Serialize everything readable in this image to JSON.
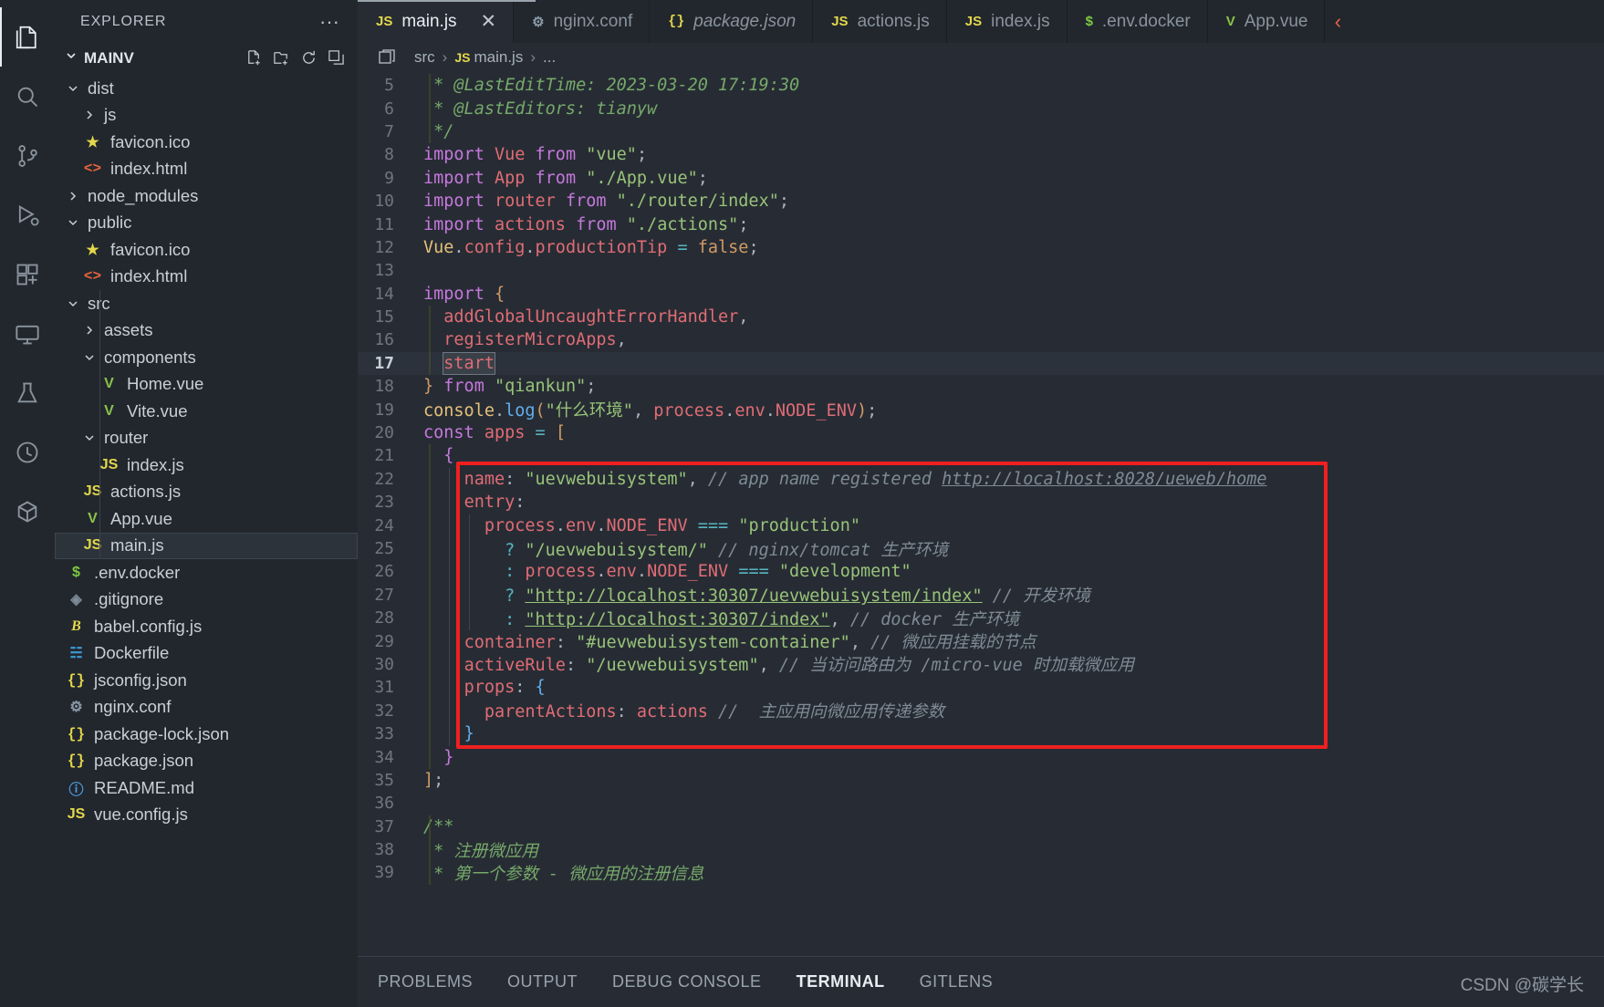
{
  "activity_bar": {
    "items": [
      {
        "name": "explorer",
        "icon": "files-icon",
        "active": true
      },
      {
        "name": "search",
        "icon": "search-icon",
        "active": false
      },
      {
        "name": "source-control",
        "icon": "source-control-icon",
        "active": false
      },
      {
        "name": "run-debug",
        "icon": "run-debug-icon",
        "active": false
      },
      {
        "name": "extensions",
        "icon": "extensions-icon",
        "active": false
      },
      {
        "name": "remote-explorer",
        "icon": "remote-explorer-icon",
        "active": false
      },
      {
        "name": "testing",
        "icon": "beaker-icon",
        "active": false
      },
      {
        "name": "dependency",
        "icon": "circle-icon",
        "active": false
      },
      {
        "name": "package",
        "icon": "package-icon",
        "active": false
      }
    ]
  },
  "sidebar": {
    "title": "EXPLORER",
    "more_actions": "···",
    "root": {
      "label": "MAINV",
      "expanded": true,
      "actions": [
        "new-file",
        "new-folder",
        "refresh",
        "collapse-all"
      ]
    },
    "tree": [
      {
        "label": "dist",
        "type": "folder",
        "expanded": true,
        "indent": 0
      },
      {
        "label": "js",
        "type": "folder",
        "expanded": false,
        "indent": 1
      },
      {
        "label": "favicon.ico",
        "type": "star",
        "indent": 1
      },
      {
        "label": "index.html",
        "type": "html",
        "indent": 1
      },
      {
        "label": "node_modules",
        "type": "folder",
        "expanded": false,
        "indent": 0
      },
      {
        "label": "public",
        "type": "folder",
        "expanded": true,
        "indent": 0
      },
      {
        "label": "favicon.ico",
        "type": "star",
        "indent": 1
      },
      {
        "label": "index.html",
        "type": "html",
        "indent": 1
      },
      {
        "label": "src",
        "type": "folder",
        "expanded": true,
        "indent": 0
      },
      {
        "label": "assets",
        "type": "folder",
        "expanded": false,
        "indent": 1
      },
      {
        "label": "components",
        "type": "folder",
        "expanded": true,
        "indent": 1
      },
      {
        "label": "Home.vue",
        "type": "vue",
        "indent": 2
      },
      {
        "label": "Vite.vue",
        "type": "vue",
        "indent": 2
      },
      {
        "label": "router",
        "type": "folder",
        "expanded": true,
        "indent": 1
      },
      {
        "label": "index.js",
        "type": "js",
        "indent": 2
      },
      {
        "label": "actions.js",
        "type": "js",
        "indent": 1
      },
      {
        "label": "App.vue",
        "type": "vue",
        "indent": 1
      },
      {
        "label": "main.js",
        "type": "js",
        "indent": 1,
        "selected": true
      },
      {
        "label": ".env.docker",
        "type": "dollar",
        "indent": 0
      },
      {
        "label": ".gitignore",
        "type": "git",
        "indent": 0
      },
      {
        "label": "babel.config.js",
        "type": "babel",
        "indent": 0
      },
      {
        "label": "Dockerfile",
        "type": "docker",
        "indent": 0
      },
      {
        "label": "jsconfig.json",
        "type": "json",
        "indent": 0
      },
      {
        "label": "nginx.conf",
        "type": "gear",
        "indent": 0
      },
      {
        "label": "package-lock.json",
        "type": "json",
        "indent": 0
      },
      {
        "label": "package.json",
        "type": "json",
        "indent": 0
      },
      {
        "label": "README.md",
        "type": "md",
        "indent": 0
      },
      {
        "label": "vue.config.js",
        "type": "js",
        "indent": 0
      }
    ]
  },
  "tabs": [
    {
      "label": "main.js",
      "icon": "js",
      "active": true,
      "italic": false,
      "close": "✕"
    },
    {
      "label": "nginx.conf",
      "icon": "gear",
      "active": false,
      "italic": false
    },
    {
      "label": "package.json",
      "icon": "json",
      "active": false,
      "italic": true
    },
    {
      "label": "actions.js",
      "icon": "js",
      "active": false,
      "italic": false
    },
    {
      "label": "index.js",
      "icon": "js",
      "active": false,
      "italic": false
    },
    {
      "label": ".env.docker",
      "icon": "dollar",
      "active": false,
      "italic": false
    },
    {
      "label": "App.vue",
      "icon": "vue",
      "active": false,
      "italic": false
    }
  ],
  "tab_overflow_icon": "chevron-left-icon",
  "breadcrumb": {
    "parts": [
      "src",
      "main.js",
      "..."
    ],
    "separator": "›"
  },
  "editor": {
    "current_line": 17,
    "selected_text": "start",
    "lines": [
      {
        "n": 5,
        "html": "<span class=\"tok-cmt\"> * @LastEditTime: 2023-03-20 17:19:30</span>"
      },
      {
        "n": 6,
        "html": "<span class=\"tok-cmt\"> * @LastEditors: tianyw</span>"
      },
      {
        "n": 7,
        "html": "<span class=\"tok-cmt\"> */</span>"
      },
      {
        "n": 8,
        "html": "<span class=\"tok-kw\">import</span> <span class=\"tok-var\">Vue</span> <span class=\"tok-kw\">from</span> <span class=\"tok-str\">\"vue\"</span><span class=\"tok-punc\">;</span>"
      },
      {
        "n": 9,
        "html": "<span class=\"tok-kw\">import</span> <span class=\"tok-var\">App</span> <span class=\"tok-kw\">from</span> <span class=\"tok-str\">\"./App.vue\"</span><span class=\"tok-punc\">;</span>"
      },
      {
        "n": 10,
        "html": "<span class=\"tok-kw\">import</span> <span class=\"tok-var\">router</span> <span class=\"tok-kw\">from</span> <span class=\"tok-str\">\"./router/index\"</span><span class=\"tok-punc\">;</span>"
      },
      {
        "n": 11,
        "html": "<span class=\"tok-kw\">import</span> <span class=\"tok-var\">actions</span> <span class=\"tok-kw\">from</span> <span class=\"tok-str\">\"./actions\"</span><span class=\"tok-punc\">;</span>"
      },
      {
        "n": 12,
        "html": "<span class=\"tok-prop\">Vue</span><span class=\"tok-punc\">.</span><span class=\"tok-var\">config</span><span class=\"tok-punc\">.</span><span class=\"tok-var\">productionTip</span> <span class=\"tok-op\">=</span> <span class=\"tok-num\">false</span><span class=\"tok-punc\">;</span>"
      },
      {
        "n": 13,
        "html": ""
      },
      {
        "n": 14,
        "html": "<span class=\"tok-kw\">import</span> <span class=\"tok-brack-o\">{</span>"
      },
      {
        "n": 15,
        "html": "  <span class=\"tok-var\">addGlobalUncaughtErrorHandler</span><span class=\"tok-punc\">,</span>"
      },
      {
        "n": 16,
        "html": "  <span class=\"tok-var\">registerMicroApps</span><span class=\"tok-punc\">,</span>"
      },
      {
        "n": 17,
        "html": "  <span class=\"sel-start tok-var\">start</span>"
      },
      {
        "n": 18,
        "html": "<span class=\"tok-brack-o\">}</span> <span class=\"tok-kw\">from</span> <span class=\"tok-str\">\"qiankun\"</span><span class=\"tok-punc\">;</span>"
      },
      {
        "n": 19,
        "html": "<span class=\"tok-prop\">console</span><span class=\"tok-punc\">.</span><span class=\"tok-fn\">log</span><span class=\"tok-brack-o\">(</span><span class=\"tok-str\">\"什么环境\"</span><span class=\"tok-punc\">, </span><span class=\"tok-var\">process</span><span class=\"tok-punc\">.</span><span class=\"tok-var\">env</span><span class=\"tok-punc\">.</span><span class=\"tok-var\">NODE_ENV</span><span class=\"tok-brack-o\">)</span><span class=\"tok-punc\">;</span>"
      },
      {
        "n": 20,
        "html": "<span class=\"tok-kw\">const</span> <span class=\"tok-var\">apps</span> <span class=\"tok-op\">=</span> <span class=\"tok-brack-o\">[</span>"
      },
      {
        "n": 21,
        "html": "  <span class=\"tok-brack-p\">{</span>"
      },
      {
        "n": 22,
        "html": "    <span class=\"tok-var\">name</span><span class=\"tok-punc\">: </span><span class=\"tok-str\">\"uevwebuisystem\"</span><span class=\"tok-punc\">, </span><span class=\"tok-cmt2\">// app name registered <span class=\"tok-link\">http://localhost:8028/ueweb/home</span></span>"
      },
      {
        "n": 23,
        "html": "    <span class=\"tok-var\">entry</span><span class=\"tok-punc\">:</span>"
      },
      {
        "n": 24,
        "html": "      <span class=\"tok-var\">process</span><span class=\"tok-punc\">.</span><span class=\"tok-var\">env</span><span class=\"tok-punc\">.</span><span class=\"tok-var\">NODE_ENV</span> <span class=\"tok-op\">===</span> <span class=\"tok-str\">\"production\"</span>"
      },
      {
        "n": 25,
        "html": "        <span class=\"tok-op\">?</span> <span class=\"tok-str\">\"/uevwebuisystem/\"</span> <span class=\"tok-cmt2\">// nginx/tomcat 生产环境</span>"
      },
      {
        "n": 26,
        "html": "        <span class=\"tok-op\">:</span> <span class=\"tok-var\">process</span><span class=\"tok-punc\">.</span><span class=\"tok-var\">env</span><span class=\"tok-punc\">.</span><span class=\"tok-var\">NODE_ENV</span> <span class=\"tok-op\">===</span> <span class=\"tok-str\">\"development\"</span>"
      },
      {
        "n": 27,
        "html": "        <span class=\"tok-op\">?</span> <span class=\"tok-str\"><span class=\"tok-link\">\"http://localhost:30307/uevwebuisystem/index\"</span></span> <span class=\"tok-cmt2\">// 开发环境</span>"
      },
      {
        "n": 28,
        "html": "        <span class=\"tok-op\">:</span> <span class=\"tok-str\"><span class=\"tok-link\">\"http://localhost:30307/index\"</span></span><span class=\"tok-punc\">, </span><span class=\"tok-cmt2\">// docker 生产环境</span>"
      },
      {
        "n": 29,
        "html": "    <span class=\"tok-var\">container</span><span class=\"tok-punc\">: </span><span class=\"tok-str\">\"#uevwebuisystem-container\"</span><span class=\"tok-punc\">, </span><span class=\"tok-cmt2\">// 微应用挂载的节点</span>"
      },
      {
        "n": 30,
        "html": "    <span class=\"tok-var\">activeRule</span><span class=\"tok-punc\">: </span><span class=\"tok-str\">\"/uevwebuisystem\"</span><span class=\"tok-punc\">, </span><span class=\"tok-cmt2\">// 当访问路由为 /micro-vue 时加载微应用</span>"
      },
      {
        "n": 31,
        "html": "    <span class=\"tok-var\">props</span><span class=\"tok-punc\">: </span><span class=\"tok-brack-b\">{</span>"
      },
      {
        "n": 32,
        "html": "      <span class=\"tok-var\">parentActions</span><span class=\"tok-punc\">: </span><span class=\"tok-var\">actions</span> <span class=\"tok-cmt2\">//  主应用向微应用传递参数</span>"
      },
      {
        "n": 33,
        "html": "    <span class=\"tok-brack-b\">}</span>"
      },
      {
        "n": 34,
        "html": "  <span class=\"tok-brack-p\">}</span>"
      },
      {
        "n": 35,
        "html": "<span class=\"tok-brack-o\">]</span><span class=\"tok-punc\">;</span>"
      },
      {
        "n": 36,
        "html": ""
      },
      {
        "n": 37,
        "html": "<span class=\"tok-cmt\">/**</span>"
      },
      {
        "n": 38,
        "html": "<span class=\"tok-cmt\"> * 注册微应用</span>"
      },
      {
        "n": 39,
        "html": "<span class=\"tok-cmt\"> * 第一个参数 - 微应用的注册信息</span>"
      }
    ],
    "annotation_box": {
      "color": "#f02020",
      "label": "red-highlight-rectangle"
    }
  },
  "panel": {
    "tabs": [
      {
        "label": "PROBLEMS",
        "active": false
      },
      {
        "label": "OUTPUT",
        "active": false
      },
      {
        "label": "DEBUG CONSOLE",
        "active": false
      },
      {
        "label": "TERMINAL",
        "active": true
      },
      {
        "label": "GITLENS",
        "active": false
      }
    ]
  },
  "watermark": "CSDN @碳学长",
  "colors": {
    "editor_bg": "#272c34",
    "sidebar_bg": "#22272e",
    "accent_red": "#f02020",
    "tab_active_bg": "#272c34"
  }
}
